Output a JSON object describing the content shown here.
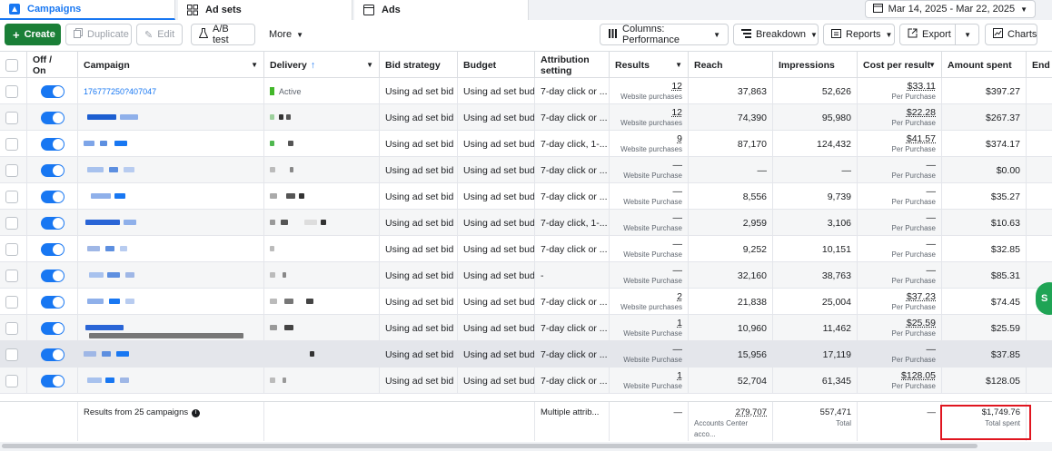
{
  "tabs": [
    {
      "label": "Campaigns",
      "icon": "campaigns-icon"
    },
    {
      "label": "Ad sets",
      "icon": "adsets-icon"
    },
    {
      "label": "Ads",
      "icon": "ads-icon"
    }
  ],
  "date_range": "Mar 14, 2025 - Mar 22, 2025",
  "toolbar": {
    "create": "Create",
    "duplicate": "Duplicate",
    "edit": "Edit",
    "ab_test": "A/B test",
    "more": "More",
    "columns": "Columns: Performance",
    "breakdown": "Breakdown",
    "reports": "Reports",
    "export": "Export",
    "charts": "Charts"
  },
  "columns": {
    "off_on": "Off / On",
    "campaign": "Campaign",
    "delivery": "Delivery",
    "bid_strategy": "Bid strategy",
    "budget": "Budget",
    "attribution": "Attribution setting",
    "results": "Results",
    "reach": "Reach",
    "impressions": "Impressions",
    "cost_per_result": "Cost per result",
    "amount_spent": "Amount spent",
    "ends": "End"
  },
  "rows": [
    {
      "campaign": "176777250?407047",
      "delivery": "Active",
      "bid": "Using ad set bid ...",
      "budget": "Using ad set bud...",
      "attr": "7-day click or ...",
      "results": "12",
      "results_label": "Website purchases",
      "reach": "37,863",
      "impr": "52,626",
      "cpr": "$33.11",
      "cpr_label": "Per Purchase",
      "spent": "$397.27"
    },
    {
      "campaign": "",
      "delivery": "",
      "bid": "Using ad set bid ...",
      "budget": "Using ad set bud...",
      "attr": "7-day click or ...",
      "results": "12",
      "results_label": "Website purchases",
      "reach": "74,390",
      "impr": "95,980",
      "cpr": "$22.28",
      "cpr_label": "Per Purchase",
      "spent": "$267.37"
    },
    {
      "campaign": "",
      "delivery": "",
      "bid": "Using ad set bid ...",
      "budget": "Using ad set bud...",
      "attr": "7-day click, 1-...",
      "results": "9",
      "results_label": "Website purchases",
      "reach": "87,170",
      "impr": "124,432",
      "cpr": "$41.57",
      "cpr_label": "Per Purchase",
      "spent": "$374.17"
    },
    {
      "campaign": "",
      "delivery": "",
      "bid": "Using ad set bid ...",
      "budget": "Using ad set bud...",
      "attr": "7-day click or ...",
      "results": "—",
      "results_label": "Website Purchase",
      "reach": "—",
      "impr": "—",
      "cpr": "—",
      "cpr_label": "Per Purchase",
      "spent": "$0.00"
    },
    {
      "campaign": "",
      "delivery": "",
      "bid": "Using ad set bid ...",
      "budget": "Using ad set bud...",
      "attr": "7-day click or ...",
      "results": "—",
      "results_label": "Website Purchase",
      "reach": "8,556",
      "impr": "9,739",
      "cpr": "—",
      "cpr_label": "Per Purchase",
      "spent": "$35.27"
    },
    {
      "campaign": "",
      "delivery": "",
      "bid": "Using ad set bid ...",
      "budget": "Using ad set bud...",
      "attr": "7-day click, 1-...",
      "results": "—",
      "results_label": "Website Purchase",
      "reach": "2,959",
      "impr": "3,106",
      "cpr": "—",
      "cpr_label": "Per Purchase",
      "spent": "$10.63"
    },
    {
      "campaign": "",
      "delivery": "",
      "bid": "Using ad set bid ...",
      "budget": "Using ad set bud...",
      "attr": "7-day click or ...",
      "results": "—",
      "results_label": "Website Purchase",
      "reach": "9,252",
      "impr": "10,151",
      "cpr": "—",
      "cpr_label": "Per Purchase",
      "spent": "$32.85"
    },
    {
      "campaign": "",
      "delivery": "",
      "bid": "Using ad set bid ...",
      "budget": "Using ad set bud...",
      "attr": "-",
      "results": "—",
      "results_label": "Website Purchase",
      "reach": "32,160",
      "impr": "38,763",
      "cpr": "—",
      "cpr_label": "Per Purchase",
      "spent": "$85.31"
    },
    {
      "campaign": "",
      "delivery": "",
      "bid": "Using ad set bid ...",
      "budget": "Using ad set bud...",
      "attr": "7-day click or ...",
      "results": "2",
      "results_label": "Website purchases",
      "reach": "21,838",
      "impr": "25,004",
      "cpr": "$37.23",
      "cpr_label": "Per Purchase",
      "spent": "$74.45"
    },
    {
      "campaign": "",
      "delivery": "",
      "bid": "Using ad set bid ...",
      "budget": "Using ad set bud...",
      "attr": "7-day click or ...",
      "results": "1",
      "results_label": "Website Purchase",
      "reach": "10,960",
      "impr": "11,462",
      "cpr": "$25.59",
      "cpr_label": "Per Purchase",
      "spent": "$25.59"
    },
    {
      "campaign": "",
      "delivery": "",
      "bid": "Using ad set bid ...",
      "budget": "Using ad set bud...",
      "attr": "7-day click or ...",
      "results": "—",
      "results_label": "Website Purchase",
      "reach": "15,956",
      "impr": "17,119",
      "cpr": "—",
      "cpr_label": "Per Purchase",
      "spent": "$37.85"
    },
    {
      "campaign": "",
      "delivery": "",
      "bid": "Using ad set bid ...",
      "budget": "Using ad set bud...",
      "attr": "7-day click or ...",
      "results": "1",
      "results_label": "Website Purchase",
      "reach": "52,704",
      "impr": "61,345",
      "cpr": "$128.05",
      "cpr_label": "Per Purchase",
      "spent": "$128.05"
    }
  ],
  "footer": {
    "summary": "Results from 25 campaigns",
    "attribution": "Multiple attrib...",
    "results": "—",
    "reach": "279,707",
    "reach_label": "Accounts Center acco...",
    "impressions": "557,471",
    "impressions_label": "Total",
    "cost": "—",
    "spent": "$1,749.76",
    "spent_label": "Total spent"
  },
  "fab_label": "S",
  "colors": {
    "accent": "#1877f2",
    "create": "#1a7f37",
    "highlight": "#e0151f"
  }
}
